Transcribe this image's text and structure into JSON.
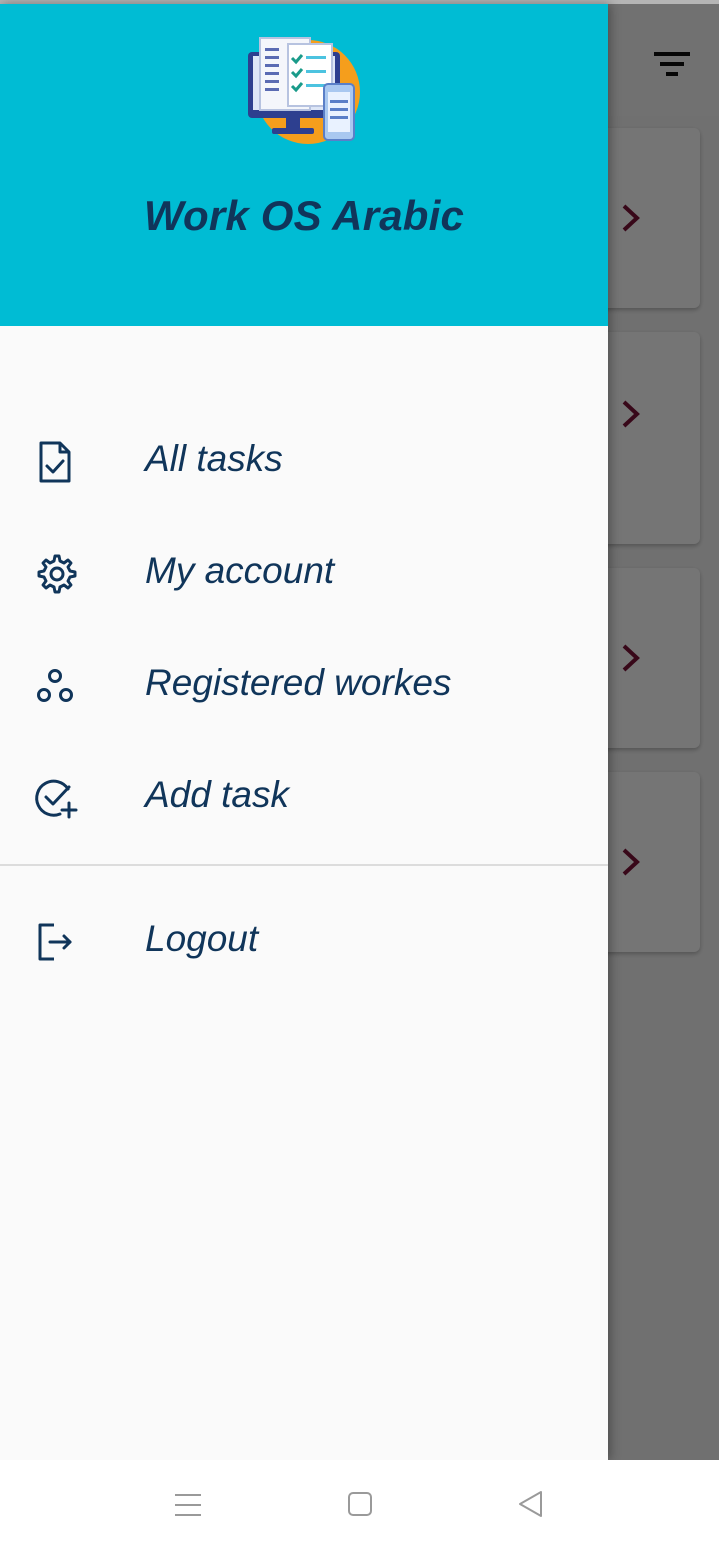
{
  "drawer": {
    "app_title": "Work OS Arabic",
    "menu_items": [
      {
        "label": "All tasks",
        "icon": "task-document-icon"
      },
      {
        "label": "My account",
        "icon": "gear-icon"
      },
      {
        "label": "Registered workes",
        "icon": "workers-icon"
      },
      {
        "label": "Add task",
        "icon": "add-task-icon"
      }
    ],
    "logout": {
      "label": "Logout",
      "icon": "logout-icon"
    }
  },
  "background": {
    "toolbar_icon": "filter-icon",
    "card_icon": "chevron-right-icon"
  },
  "system_nav": {
    "buttons": [
      "menu-icon",
      "home-icon",
      "back-icon"
    ]
  },
  "colors": {
    "header": "#00bcd4",
    "text": "#10355a",
    "drawer_bg": "#fafafa",
    "chevron": "#7a1238"
  }
}
